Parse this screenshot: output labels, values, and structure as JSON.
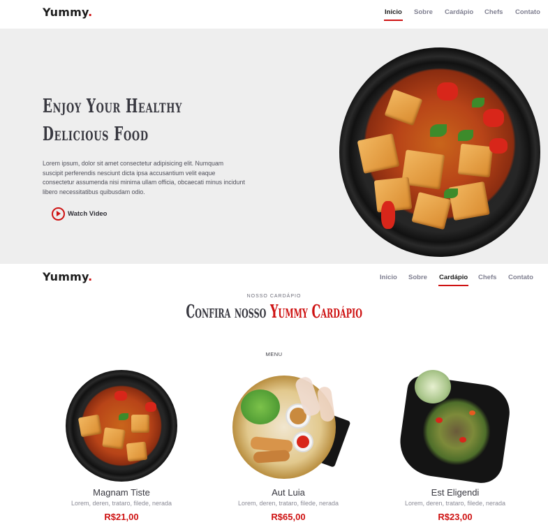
{
  "brand": {
    "name": "Yummy",
    "dot": "."
  },
  "nav": {
    "items": [
      "Inicio",
      "Sobre",
      "Cardápio",
      "Chefs",
      "Contato"
    ]
  },
  "hero": {
    "title_line1": "Enjoy Your Healthy",
    "title_line2": "Delicious Food",
    "text": "Lorem ipsum, dolor sit amet consectetur adipisicing elit. Numquam suscipit perferendis nesciunt dicta ipsa accusantium velit eaque consectetur assumenda nisi minima ullam officia, obcaecati minus incidunt libero necessitatibus quibusdam odio.",
    "watch_label": "Watch Video"
  },
  "menu_section": {
    "subtitle": "NOSSO CARDÁPIO",
    "title_plain": "Confira nosso",
    "title_accent": "Yummy Cardápio",
    "tab": "MENU",
    "items": [
      {
        "name": "Magnam Tiste",
        "desc": "Lorem, deren, trataro, filede, nerada",
        "price": "R$21,00"
      },
      {
        "name": "Aut Luia",
        "desc": "Lorem, deren, trataro, filede, nerada",
        "price": "R$65,00"
      },
      {
        "name": "Est Eligendi",
        "desc": "Lorem, deren, trataro, filede, nerada",
        "price": "R$23,00"
      }
    ]
  },
  "colors": {
    "accent": "#ce1212",
    "hero_bg": "#eeeeee",
    "text_dark": "#37373f"
  }
}
